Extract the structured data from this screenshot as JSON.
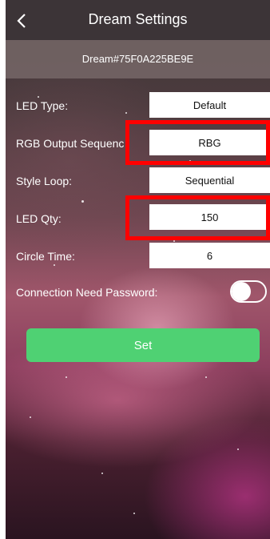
{
  "header": {
    "title": "Dream Settings",
    "back_icon": "chevron-left-icon"
  },
  "device": {
    "id": "Dream#75F0A225BE9E"
  },
  "settings": {
    "led_type": {
      "label": "LED Type:",
      "value": "Default"
    },
    "rgb_output_sequence": {
      "label": "RGB Output Sequenc  :",
      "value": "RBG"
    },
    "style_loop": {
      "label": "Style Loop:",
      "value": "Sequential"
    },
    "led_qty": {
      "label": "LED Qty:",
      "value": "150"
    },
    "circle_time": {
      "label": "Circle Time:",
      "value": "6"
    },
    "connection_password": {
      "label": "Connection Need Password:",
      "enabled": false
    }
  },
  "actions": {
    "set_label": "Set"
  },
  "colors": {
    "header_bg": "#3c3437",
    "accent_green": "#4fd173",
    "highlight_red": "#ff0000"
  }
}
